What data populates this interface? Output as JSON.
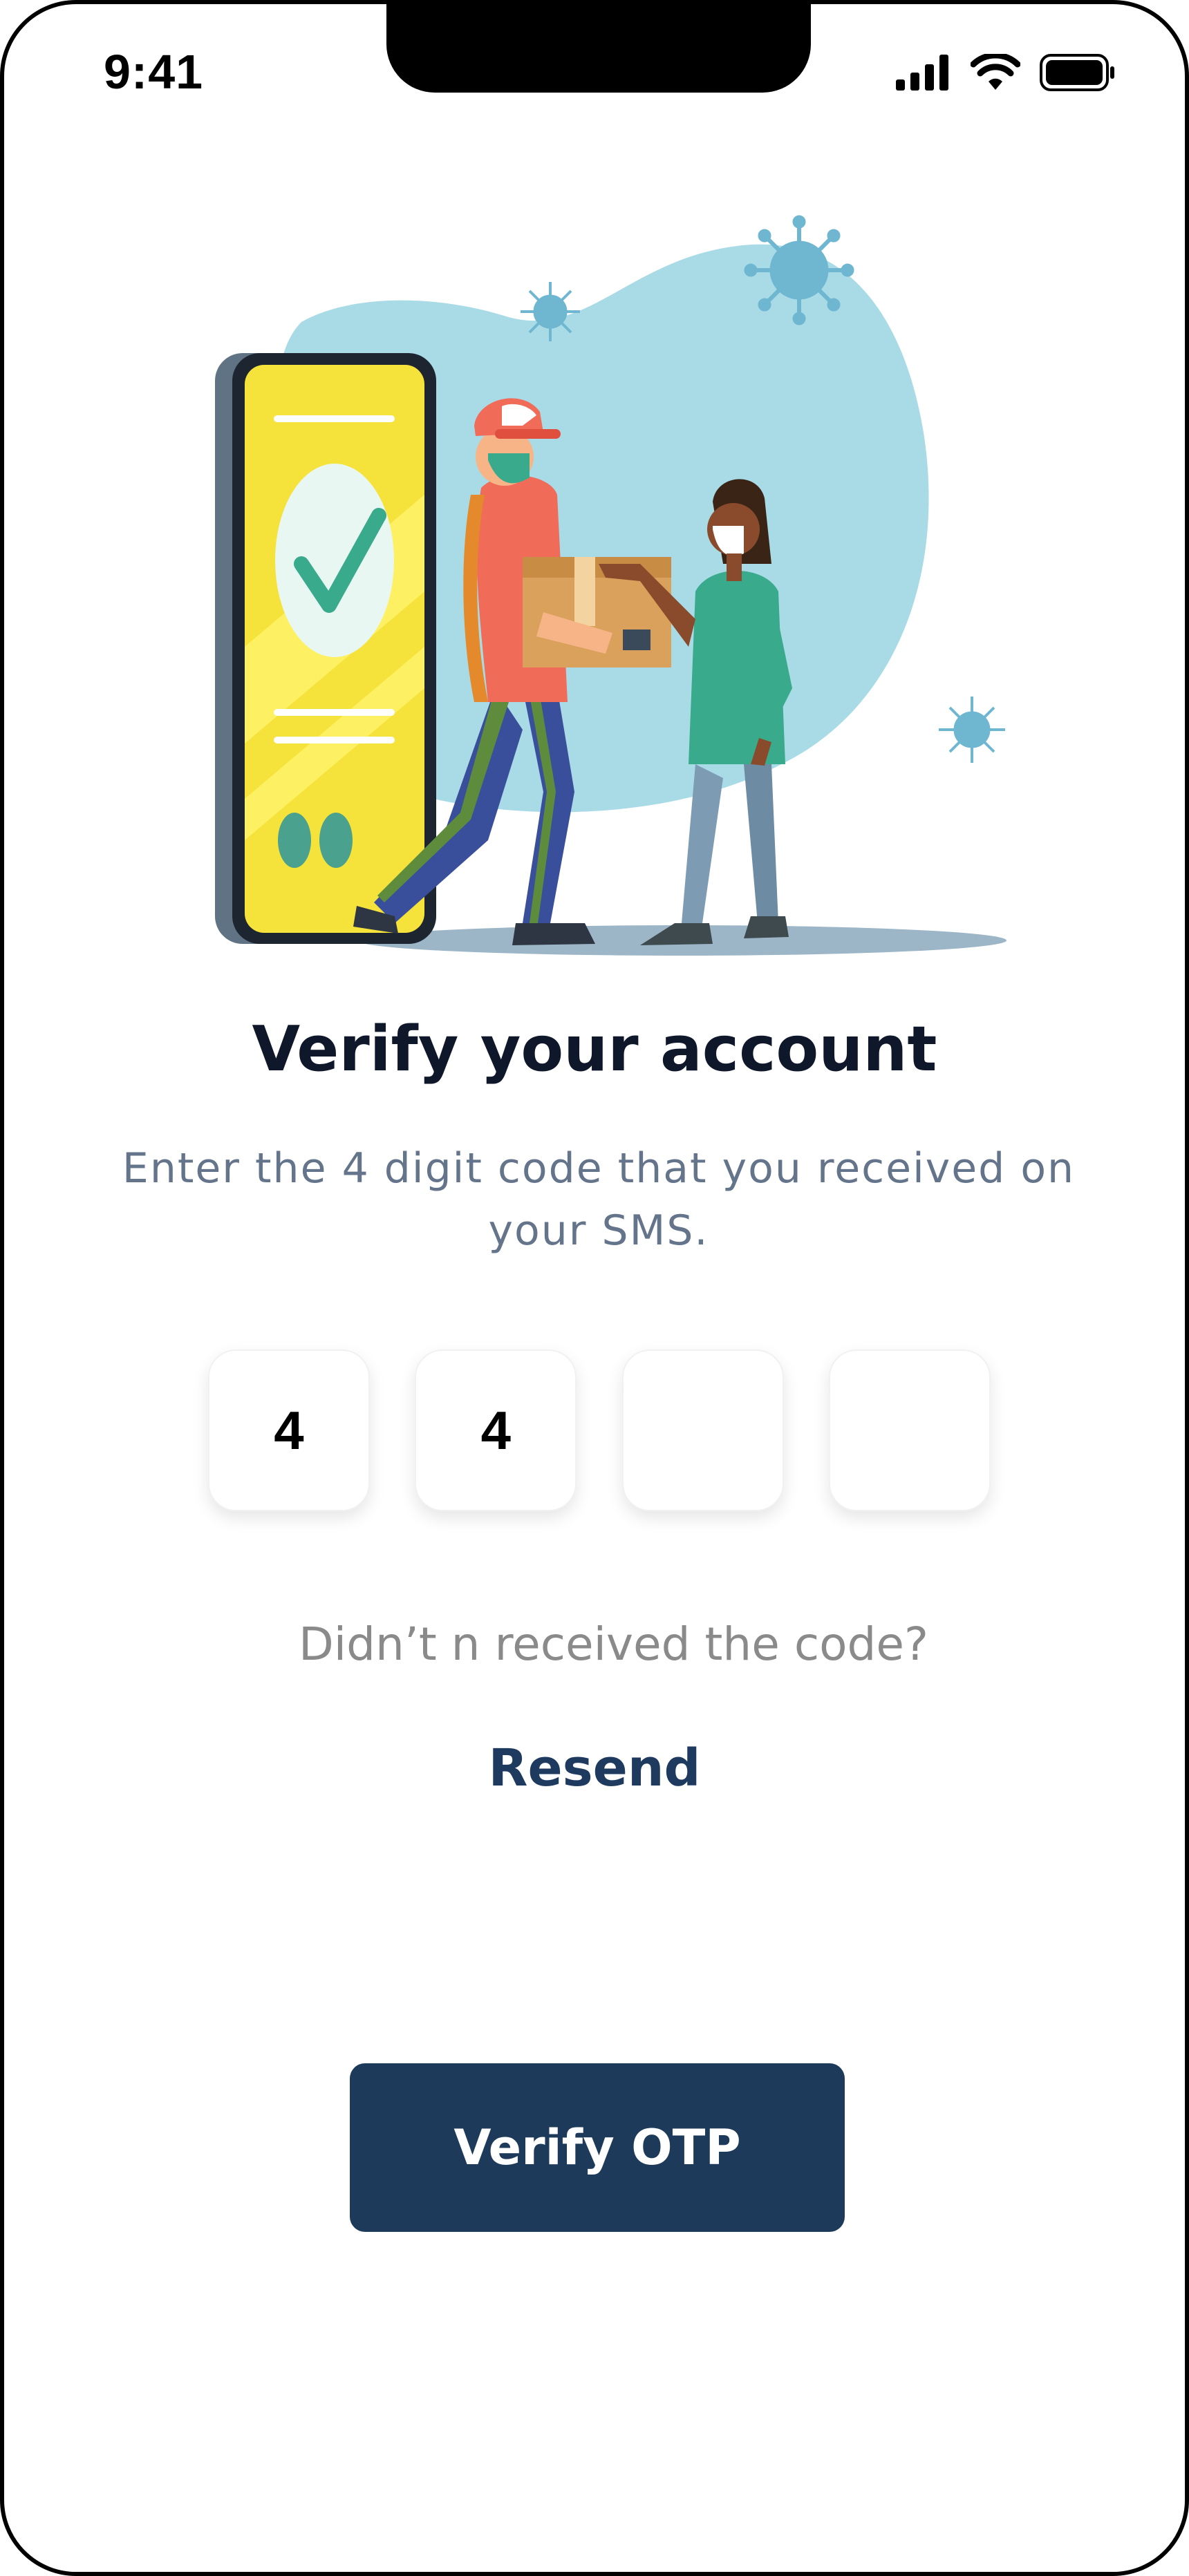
{
  "status_bar": {
    "time": "9:41",
    "icons": [
      "cellular-signal-icon",
      "wifi-icon",
      "battery-icon"
    ]
  },
  "hero": {
    "illustration": "delivery-verification-illustration"
  },
  "content": {
    "title": "Verify your account",
    "subtitle": "Enter the 4 digit code that you received on your SMS."
  },
  "otp": {
    "digits": [
      "4",
      "4",
      "",
      ""
    ]
  },
  "resend": {
    "prompt": "Didn’t n received the code?",
    "link_label": "Resend"
  },
  "actions": {
    "verify_label": "Verify OTP"
  },
  "colors": {
    "primary": "#1e3a5a",
    "title": "#0f172a",
    "subtitle": "#64748b",
    "muted": "#8a8a8a",
    "blob": "#a9dbe6",
    "phone_screen": "#f5e23a"
  }
}
